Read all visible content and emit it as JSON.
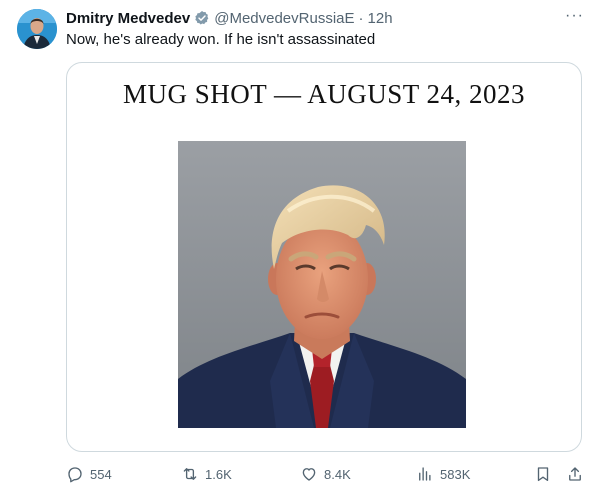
{
  "tweet": {
    "author_name": "Dmitry Medvedev",
    "handle": "@MedvedevRussiaE",
    "separator": "·",
    "time": "12h",
    "text": "Now, he's already won. If he isn't assassinated",
    "more_label": "···"
  },
  "media": {
    "title": "MUG SHOT — AUGUST 24, 2023"
  },
  "actions": {
    "replies": "554",
    "retweets": "1.6K",
    "likes": "8.4K",
    "views": "583K"
  },
  "colors": {
    "verified": "#829aab",
    "muted": "#536471",
    "border": "#cfd9de"
  },
  "icons": [
    "verified-badge-icon",
    "more-icon",
    "reply-icon",
    "retweet-icon",
    "like-icon",
    "views-icon",
    "bookmark-icon",
    "share-icon"
  ]
}
